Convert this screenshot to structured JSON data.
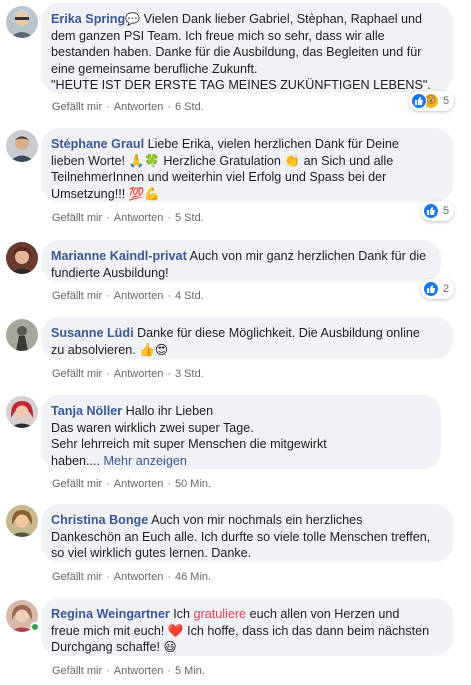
{
  "actions": {
    "like": "Gefällt mir",
    "reply": "Antworten",
    "dot": "·"
  },
  "comments": [
    {
      "author": "Erika Spring",
      "lines": [
        "Vielen Dank lieber Gabriel, Stèphan, Raphael und",
        "dem ganzen PSI Team. Ich freue mich so sehr, dass wir alle",
        "bestanden haben. Danke für die Ausbildung, das Begleiten und für",
        "eine gemeinsame berufliche Zukunft.",
        "\"HEUTE IST DER ERSTE TAG MEINES ZUKÜNFTIGEN LEBENS\"."
      ],
      "time": "6 Std.",
      "reaction_count": "5",
      "avatar_color": "#7a8a99"
    },
    {
      "author": "Stéphane Graul",
      "lines": [
        "Liebe Erika, vielen herzlichen Dank für Deine",
        "lieben Worte! 🙏🍀 Herzliche Gratulation 👏 an Sich und alle",
        "TeilnehmerInnen und weiterhin viel Erfolg und Spass bei der",
        "Umsetzung!!! 💯💪"
      ],
      "time": "5 Std.",
      "reaction_count": "5",
      "avatar_color": "#556270"
    },
    {
      "author": "Marianne Kaindl-privat",
      "lines": [
        "Auch von mir ganz herzlichen Dank für die",
        "fundierte Ausbildung!"
      ],
      "time": "4 Std.",
      "reaction_count": "2",
      "avatar_color": "#8a4a3a"
    },
    {
      "author": "Susanne Lüdi",
      "lines": [
        "Danke für diese Möglichkeit. Die Ausbildung online",
        "zu absolvieren. 👍😍"
      ],
      "time": "3 Std.",
      "avatar_color": "#9a9a8a"
    },
    {
      "author": "Tanja Nöller",
      "lines": [
        "Hallo ihr Lieben",
        "Das waren wirklich zwei super Tage.",
        "Sehr lehrreich mit super Menschen die mitgewirkt",
        "haben...."
      ],
      "more": "Mehr anzeigen",
      "time": "50 Min.",
      "avatar_color": "#c0404a"
    },
    {
      "author": "Christina Bonge",
      "lines": [
        "Auch von mir nochmals ein herzliches",
        "Dankeschön an Euch alle. Ich durfte so viele tolle Menschen treffen,",
        "so viel wirklich gutes lernen. Danke."
      ],
      "time": "46 Min.",
      "avatar_color": "#b08a50"
    },
    {
      "author": "Regina Weingartner",
      "pre": "Ich",
      "highlight": "gratuliere",
      "lines": [
        "euch allen von Herzen und",
        "freue mich mit euch! ❤️ Ich hoffe, dass ich das dann beim nächsten",
        "Durchgang schaffe! 😃"
      ],
      "time": "5 Min.",
      "avatar_color": "#c08070"
    }
  ]
}
